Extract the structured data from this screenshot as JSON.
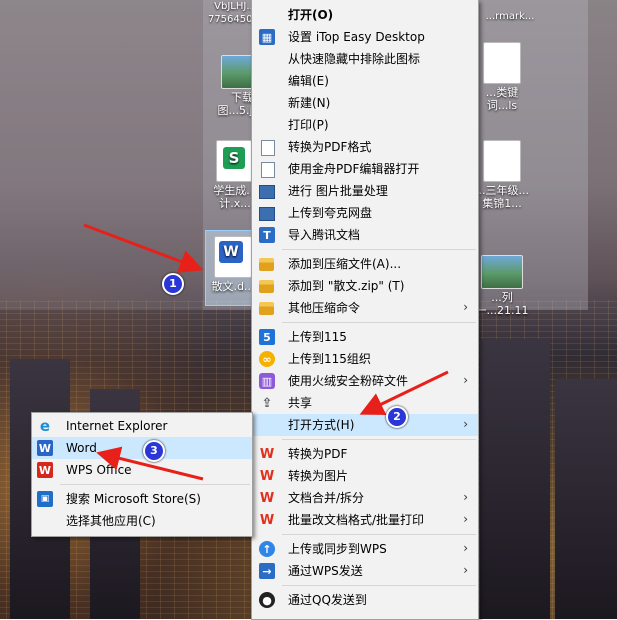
{
  "desktop": {
    "top_labels": [
      "VbJLHJ...",
      "7756450...",
      "...rmark..."
    ],
    "icons": [
      {
        "label": "下载图...5.jpg",
        "type": "image"
      },
      {
        "label": "学生成...计.x...",
        "type": "spreadsheet"
      },
      {
        "label": "...类键词...ls",
        "type": "document"
      },
      {
        "label": "...三年级...集锦1...",
        "type": "document"
      },
      {
        "label": "散文.d...",
        "type": "word"
      },
      {
        "label": "...列一...21.11",
        "type": "image"
      }
    ]
  },
  "context_menu": {
    "items": [
      {
        "label": "打开(O)",
        "icon": "none",
        "bold": true
      },
      {
        "label": "设置 iTop Easy Desktop",
        "icon": "itop-icon"
      },
      {
        "label": "从快速隐藏中排除此图标",
        "icon": "none"
      },
      {
        "label": "编辑(E)",
        "icon": "none"
      },
      {
        "label": "新建(N)",
        "icon": "none"
      },
      {
        "label": "打印(P)",
        "icon": "none"
      },
      {
        "label": "转换为PDF格式",
        "icon": "document-icon"
      },
      {
        "label": "使用金舟PDF编辑器打开",
        "icon": "document-icon"
      },
      {
        "label": "进行 图片批量处理",
        "icon": "image-icon"
      },
      {
        "label": "上传到夸克网盘",
        "icon": "image-icon"
      },
      {
        "label": "导入腾讯文档",
        "icon": "tencent-docs-icon"
      },
      {
        "label": "添加到压缩文件(A)...",
        "icon": "archive-icon"
      },
      {
        "label": "添加到 \"散文.zip\" (T)",
        "icon": "archive-icon"
      },
      {
        "label": "其他压缩命令",
        "icon": "archive-icon",
        "submenu": true
      },
      {
        "label": "上传到115",
        "icon": "115-icon"
      },
      {
        "label": "上传到115组织",
        "icon": "115-org-icon"
      },
      {
        "label": "使用火绒安全粉碎文件",
        "icon": "shredder-icon",
        "submenu": true
      },
      {
        "label": "共享",
        "icon": "share-icon"
      },
      {
        "label": "打开方式(H)",
        "icon": "none",
        "submenu": true,
        "highlighted": true
      },
      {
        "label": "转换为PDF",
        "icon": "wps-icon"
      },
      {
        "label": "转换为图片",
        "icon": "wps-icon"
      },
      {
        "label": "文档合并/拆分",
        "icon": "wps-icon",
        "submenu": true
      },
      {
        "label": "批量改文档格式/批量打印",
        "icon": "wps-icon",
        "submenu": true
      },
      {
        "label": "上传或同步到WPS",
        "icon": "cloud-upload-icon",
        "submenu": true
      },
      {
        "label": "通过WPS发送",
        "icon": "send-icon",
        "submenu": true
      },
      {
        "label": "通过QQ发送到",
        "icon": "qq-icon"
      }
    ]
  },
  "open_with_menu": {
    "items": [
      {
        "label": "Internet Explorer",
        "icon": "ie-icon"
      },
      {
        "label": "Word",
        "icon": "word-icon",
        "highlighted": true
      },
      {
        "label": "WPS Office",
        "icon": "wps-office-icon"
      },
      {
        "label": "搜索 Microsoft Store(S)",
        "icon": "store-icon"
      },
      {
        "label": "选择其他应用(C)",
        "icon": "none"
      }
    ]
  },
  "annotations": {
    "badges": [
      "1",
      "2",
      "3"
    ],
    "arrow_color": "#e8201a",
    "badge_color": "#2a36d8"
  },
  "colors": {
    "menu_background": "#f2f2f2",
    "highlight": "#cce8ff"
  },
  "glyphs": {
    "chevron": "›",
    "itop": "▦",
    "tencent": "T",
    "115": "5",
    "115org": "∞",
    "shred": "▥",
    "share": "⇪",
    "wps": "W",
    "cloud": "↑",
    "send": "→",
    "qq": "●",
    "ie": "e",
    "word": "W",
    "wpsoffice": "W",
    "store": "▣"
  }
}
